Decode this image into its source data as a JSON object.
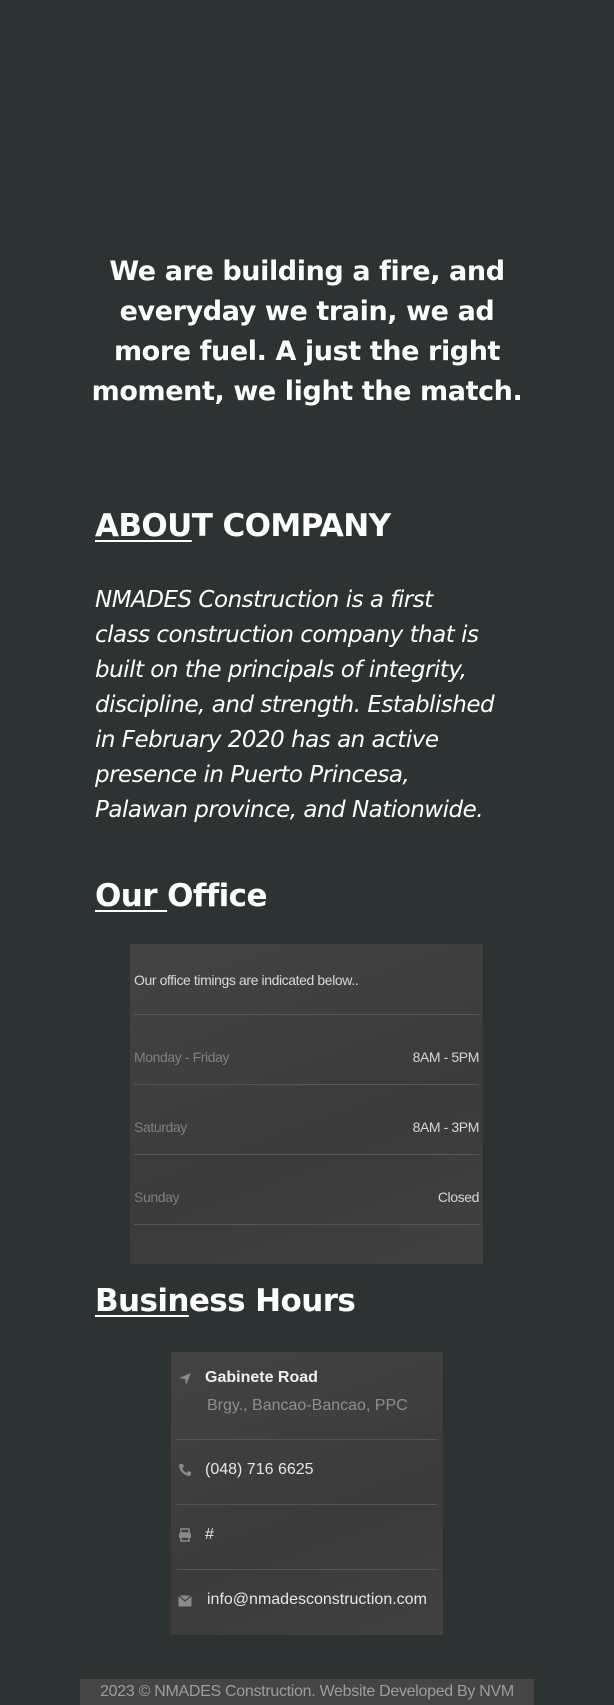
{
  "quote": {
    "lines": [
      "We are building a fire, and",
      "everyday we train, we ad",
      "more fuel. A just the right",
      "moment, we light the match."
    ]
  },
  "about": {
    "heading_underlined": "ABOU",
    "heading_rest": "T COMPANY",
    "lines": [
      "NMADES Construction is a first",
      "class construction company that is",
      "built on the principals of integrity,",
      "discipline, and strength. Established",
      "in February 2020 has an active",
      "presence in Puerto Princesa,",
      "Palawan province, and Nationwide."
    ]
  },
  "office": {
    "heading_underlined": "Our ",
    "heading_rest": "Office",
    "intro": "Our office timings are indicated below..",
    "rows": [
      {
        "day": "Monday - Friday",
        "time": "8AM - 5PM"
      },
      {
        "day": "Saturday",
        "time": "8AM - 3PM"
      },
      {
        "day": "Sunday",
        "time": "Closed"
      }
    ]
  },
  "hours": {
    "heading_underlined": "Busin",
    "heading_rest": "ess Hours"
  },
  "contact": {
    "address_title": "Gabinete Road",
    "address_sub": "Brgy., Bancao-Bancao, PPC",
    "phone": "(048) 716 6625",
    "fax": "#",
    "email": "info@nmadesconstruction.com",
    "icons": {
      "address": "location-arrow-icon",
      "phone": "phone-icon",
      "fax": "printer-icon",
      "email": "envelope-icon"
    }
  },
  "footer": {
    "text": "2023 © NMADES Construction. Website Developed By NVM"
  },
  "colors": {
    "background": "#2c3332",
    "panel": "#3d3d3d",
    "text": "#ffffff"
  }
}
